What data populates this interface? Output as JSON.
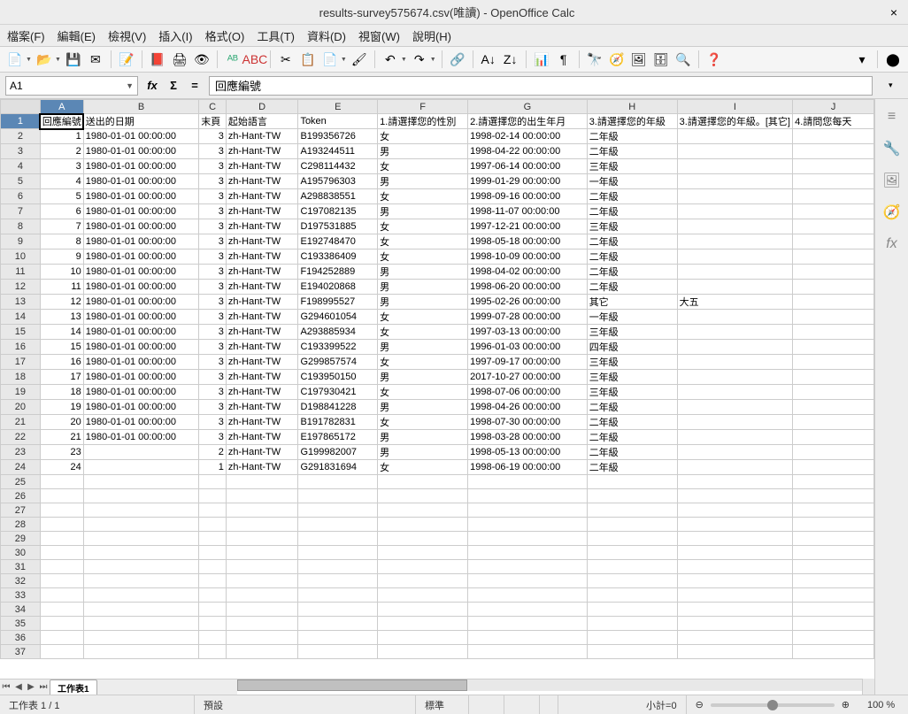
{
  "window": {
    "title": "results-survey575674.csv(唯讀) - OpenOffice Calc",
    "close": "×"
  },
  "menu": {
    "file": "檔案(F)",
    "edit": "編輯(E)",
    "view": "檢視(V)",
    "insert": "插入(I)",
    "format": "格式(O)",
    "tools": "工具(T)",
    "data": "資料(D)",
    "window": "視窗(W)",
    "help": "說明(H)"
  },
  "cellref": "A1",
  "formula_value": "回應編號",
  "columns": [
    "A",
    "B",
    "C",
    "D",
    "E",
    "F",
    "G",
    "H",
    "I",
    "J"
  ],
  "col_widths": [
    "col-A",
    "col-B",
    "col-C",
    "col-D",
    "col-E",
    "col-F",
    "col-G",
    "col-H",
    "col-I",
    "col-J"
  ],
  "headers": [
    "回應編號",
    "送出的日期",
    "末頁",
    "起始語言",
    "Token",
    "1.請選擇您的性別",
    "2.請選擇您的出生年月",
    "3.請選擇您的年級",
    "3.請選擇您的年級。[其它]",
    "4.請問您每天"
  ],
  "rows": [
    [
      "1",
      "1980-01-01 00:00:00",
      "3",
      "zh-Hant-TW",
      "B199356726",
      "女",
      "1998-02-14 00:00:00",
      "二年級",
      "",
      ""
    ],
    [
      "2",
      "1980-01-01 00:00:00",
      "3",
      "zh-Hant-TW",
      "A193244511",
      "男",
      "1998-04-22 00:00:00",
      "二年級",
      "",
      ""
    ],
    [
      "3",
      "1980-01-01 00:00:00",
      "3",
      "zh-Hant-TW",
      "C298114432",
      "女",
      "1997-06-14 00:00:00",
      "三年級",
      "",
      ""
    ],
    [
      "4",
      "1980-01-01 00:00:00",
      "3",
      "zh-Hant-TW",
      "A195796303",
      "男",
      "1999-01-29 00:00:00",
      "一年級",
      "",
      ""
    ],
    [
      "5",
      "1980-01-01 00:00:00",
      "3",
      "zh-Hant-TW",
      "A298838551",
      "女",
      "1998-09-16 00:00:00",
      "二年級",
      "",
      ""
    ],
    [
      "6",
      "1980-01-01 00:00:00",
      "3",
      "zh-Hant-TW",
      "C197082135",
      "男",
      "1998-11-07 00:00:00",
      "二年級",
      "",
      ""
    ],
    [
      "7",
      "1980-01-01 00:00:00",
      "3",
      "zh-Hant-TW",
      "D197531885",
      "女",
      "1997-12-21 00:00:00",
      "三年級",
      "",
      ""
    ],
    [
      "8",
      "1980-01-01 00:00:00",
      "3",
      "zh-Hant-TW",
      "E192748470",
      "女",
      "1998-05-18 00:00:00",
      "二年級",
      "",
      ""
    ],
    [
      "9",
      "1980-01-01 00:00:00",
      "3",
      "zh-Hant-TW",
      "C193386409",
      "女",
      "1998-10-09 00:00:00",
      "二年級",
      "",
      ""
    ],
    [
      "10",
      "1980-01-01 00:00:00",
      "3",
      "zh-Hant-TW",
      "F194252889",
      "男",
      "1998-04-02 00:00:00",
      "二年級",
      "",
      ""
    ],
    [
      "11",
      "1980-01-01 00:00:00",
      "3",
      "zh-Hant-TW",
      "E194020868",
      "男",
      "1998-06-20 00:00:00",
      "二年級",
      "",
      ""
    ],
    [
      "12",
      "1980-01-01 00:00:00",
      "3",
      "zh-Hant-TW",
      "F198995527",
      "男",
      "1995-02-26 00:00:00",
      "其它",
      "大五",
      ""
    ],
    [
      "13",
      "1980-01-01 00:00:00",
      "3",
      "zh-Hant-TW",
      "G294601054",
      "女",
      "1999-07-28 00:00:00",
      "一年級",
      "",
      ""
    ],
    [
      "14",
      "1980-01-01 00:00:00",
      "3",
      "zh-Hant-TW",
      "A293885934",
      "女",
      "1997-03-13 00:00:00",
      "三年級",
      "",
      ""
    ],
    [
      "15",
      "1980-01-01 00:00:00",
      "3",
      "zh-Hant-TW",
      "C193399522",
      "男",
      "1996-01-03 00:00:00",
      "四年級",
      "",
      ""
    ],
    [
      "16",
      "1980-01-01 00:00:00",
      "3",
      "zh-Hant-TW",
      "G299857574",
      "女",
      "1997-09-17 00:00:00",
      "三年級",
      "",
      ""
    ],
    [
      "17",
      "1980-01-01 00:00:00",
      "3",
      "zh-Hant-TW",
      "C193950150",
      "男",
      "2017-10-27 00:00:00",
      "三年級",
      "",
      ""
    ],
    [
      "18",
      "1980-01-01 00:00:00",
      "3",
      "zh-Hant-TW",
      "C197930421",
      "女",
      "1998-07-06 00:00:00",
      "三年級",
      "",
      ""
    ],
    [
      "19",
      "1980-01-01 00:00:00",
      "3",
      "zh-Hant-TW",
      "D198841228",
      "男",
      "1998-04-26 00:00:00",
      "二年級",
      "",
      ""
    ],
    [
      "20",
      "1980-01-01 00:00:00",
      "3",
      "zh-Hant-TW",
      "B191782831",
      "女",
      "1998-07-30 00:00:00",
      "二年級",
      "",
      ""
    ],
    [
      "21",
      "1980-01-01 00:00:00",
      "3",
      "zh-Hant-TW",
      "E197865172",
      "男",
      "1998-03-28 00:00:00",
      "二年級",
      "",
      ""
    ],
    [
      "23",
      "",
      "2",
      "zh-Hant-TW",
      "G199982007",
      "男",
      "1998-05-13 00:00:00",
      "二年級",
      "",
      ""
    ],
    [
      "24",
      "",
      "1",
      "zh-Hant-TW",
      "G291831694",
      "女",
      "1998-06-19 00:00:00",
      "二年級",
      "",
      ""
    ]
  ],
  "empty_row_count": 13,
  "sheet_tab": "工作表1",
  "status": {
    "sheet": "工作表 1 / 1",
    "style": "預設",
    "mode": "標準",
    "sum": "小計=0",
    "zoom": "100 %",
    "minus": "⊖",
    "plus": "⊕"
  }
}
